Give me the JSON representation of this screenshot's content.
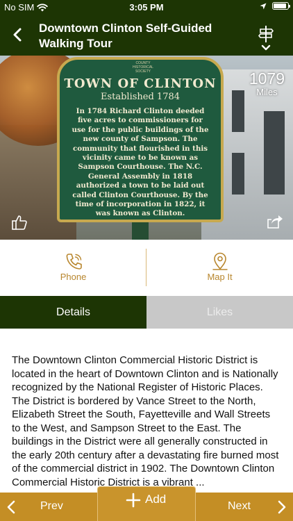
{
  "status_bar": {
    "carrier": "No SIM",
    "time": "3:05 PM",
    "battery_level": 0.92,
    "icons": [
      "wifi-icon",
      "location-arrow-icon",
      "battery-icon"
    ]
  },
  "nav": {
    "title": "Downtown Clinton Self-Guided Walking Tour",
    "back_icon": "chevron-left-icon",
    "right_icon": "signpost-icon"
  },
  "hero": {
    "sign": {
      "crest": "COUNTY HISTORICAL SOCIETY",
      "title": "TOWN OF CLINTON",
      "subtitle": "Established 1784",
      "body": "In 1784 Richard Clinton deeded five acres to commissioners for use for the public buildings of the new county of Sampson. The community that flourished in this vicinity came to be known as Sampson Courthouse. The N.C. General Assembly in 1818 authorized a town to be laid out called Clinton Courthouse. By the time of incorporation in 1822, it was known as Clinton."
    },
    "distance": {
      "value": "1079",
      "unit": "Miles"
    },
    "like_icon": "thumbs-up-icon",
    "share_icon": "share-icon"
  },
  "actions": [
    {
      "label": "Phone",
      "icon": "phone-icon"
    },
    {
      "label": "Map It",
      "icon": "map-pin-icon"
    }
  ],
  "tabs": {
    "details": "Details",
    "likes": "Likes",
    "active": "details"
  },
  "description": "The Downtown Clinton Commercial Historic District is located in the heart of Downtown Clinton and is Nationally recognized by the National Register of Historic Places.  The District is bordered by Vance Street to the North, Elizabeth Street the South, Fayetteville and Wall Streets to the West, and Sampson Street to the East.  The buildings in the District were all generally constructed in the early 20th century after a devastating fire burned most of the commercial district in 1902.   The Downtown Clinton Commercial Historic District is a vibrant ...",
  "bottom_bar": {
    "prev": "Prev",
    "add": "Add",
    "next": "Next"
  },
  "colors": {
    "primary_green": "#1d3504",
    "accent_gold": "#c48e25",
    "tab_inactive": "#c8c8c8",
    "action_text": "#b8862d"
  }
}
